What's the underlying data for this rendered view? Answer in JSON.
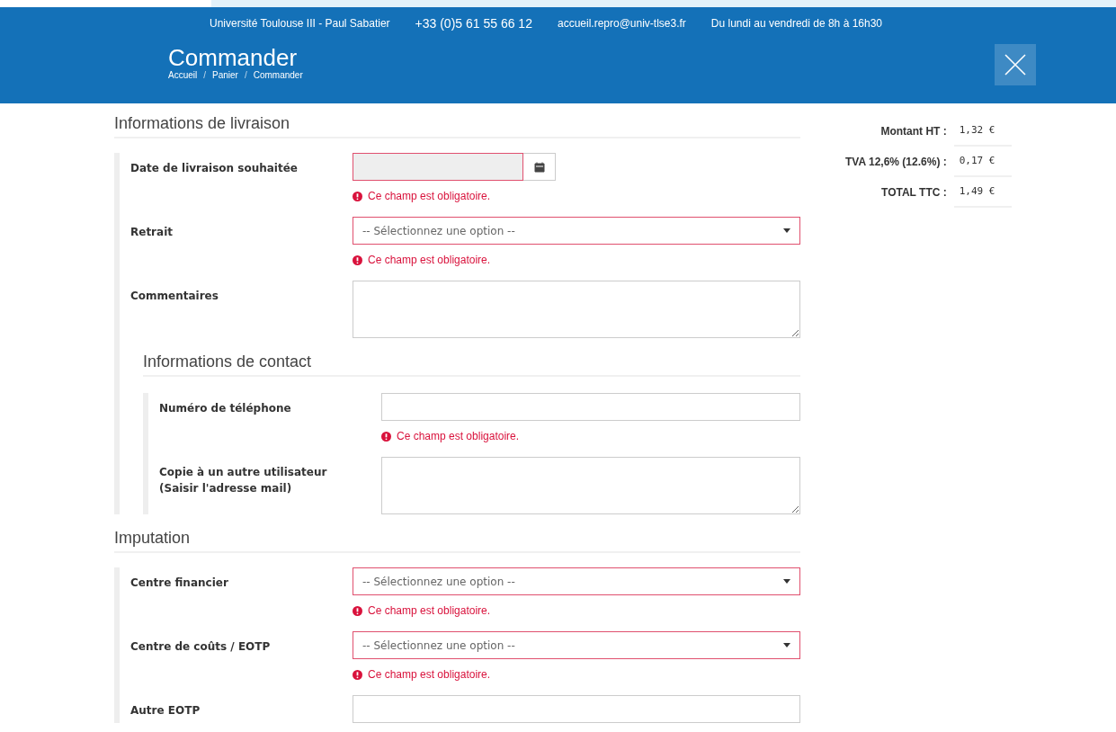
{
  "header": {
    "info": [
      "Université Toulouse III - Paul Sabatier",
      "+33 (0)5 61 55 66 12",
      "accueil.repro@univ-tlse3.fr",
      "Du lundi au vendredi de 8h à 16h30"
    ],
    "title": "Commander",
    "breadcrumb": [
      "Accueil",
      "Panier",
      "Commander"
    ],
    "separator": "/"
  },
  "sections": [
    {
      "title": "Informations de livraison",
      "fields": [
        {
          "label": "Date de livraison souhaitée",
          "kind": "date",
          "invalid": true,
          "error": "Ce champ est obligatoire."
        },
        {
          "label": "Retrait",
          "kind": "select",
          "placeholder": "-- Sélectionnez une option --",
          "invalid": true,
          "error": "Ce champ est obligatoire."
        },
        {
          "label": "Commentaires",
          "kind": "textarea",
          "invalid": false
        }
      ],
      "children": [
        {
          "title": "Informations de contact",
          "fields": [
            {
              "label": "Numéro de téléphone",
              "kind": "text",
              "invalid": false,
              "error": "Ce champ est obligatoire."
            },
            {
              "label": "Copie à un autre utilisateur (Saisir l'adresse mail)",
              "kind": "textarea",
              "invalid": false
            }
          ]
        }
      ]
    },
    {
      "title": "Imputation",
      "fields": [
        {
          "label": "Centre financier",
          "kind": "select",
          "placeholder": "-- Sélectionnez une option --",
          "invalid": true,
          "error": "Ce champ est obligatoire."
        },
        {
          "label": "Centre de coûts / EOTP",
          "kind": "select",
          "placeholder": "-- Sélectionnez une option --",
          "invalid": true,
          "error": "Ce champ est obligatoire."
        },
        {
          "label": "Autre EOTP",
          "kind": "text",
          "invalid": false
        }
      ]
    }
  ],
  "totals": [
    {
      "label": "Montant HT :",
      "value": "1,32 €"
    },
    {
      "label": "TVA 12,6% (12.6%) :",
      "value": "0,17 €"
    },
    {
      "label": "TOTAL TTC :",
      "value": "1,49 €"
    }
  ]
}
